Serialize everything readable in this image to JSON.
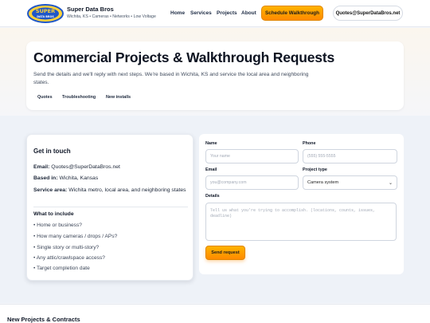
{
  "header": {
    "logo_text": "SUPER DATA BROS",
    "brand_name": "Super Data Bros",
    "tagline": "Wichita, KS • Cameras • Networks • Low Voltage",
    "nav": [
      "Home",
      "Services",
      "Projects",
      "About"
    ],
    "cta_label": "Schedule Walkthrough",
    "email_pill": "Quotes@SuperDataBros.net",
    "colors": {
      "accent": "#ff9a00",
      "brand_blue": "#1f57c8",
      "brand_yellow": "#ffd23a"
    }
  },
  "hero": {
    "title": "Commercial Projects & Walkthrough Requests",
    "description": "Send the details and we'll reply with next steps. We're based in Wichita, KS and service the local area and neighboring states.",
    "pills": [
      "Quotes",
      "Troubleshooting",
      "New installs"
    ]
  },
  "contact": {
    "heading": "Get in touch",
    "email_label": "Email:",
    "email_value": "Quotes@SuperDataBros.net",
    "based_label": "Based in:",
    "based_value": "Wichita, Kansas",
    "area_label": "Service area:",
    "area_value": "Wichita metro, local area, and neighboring states",
    "include_heading": "What to include",
    "include_items": [
      "Home or business?",
      "How many cameras / drops / APs?",
      "Single story or multi-story?",
      "Any attic/crawlspace access?",
      "Target completion date"
    ]
  },
  "form": {
    "name_label": "Name",
    "name_placeholder": "Your name",
    "phone_label": "Phone",
    "phone_placeholder": "(555) 555-5555",
    "email_label": "Email",
    "email_placeholder": "you@company.com",
    "type_label": "Project type",
    "type_value": "Camera system",
    "details_label": "Details",
    "details_placeholder": "Tell us what you're trying to accomplish. (locations, counts, issues, deadline)",
    "submit_label": "Send request"
  },
  "bottom": {
    "title": "New Projects & Contracts"
  }
}
